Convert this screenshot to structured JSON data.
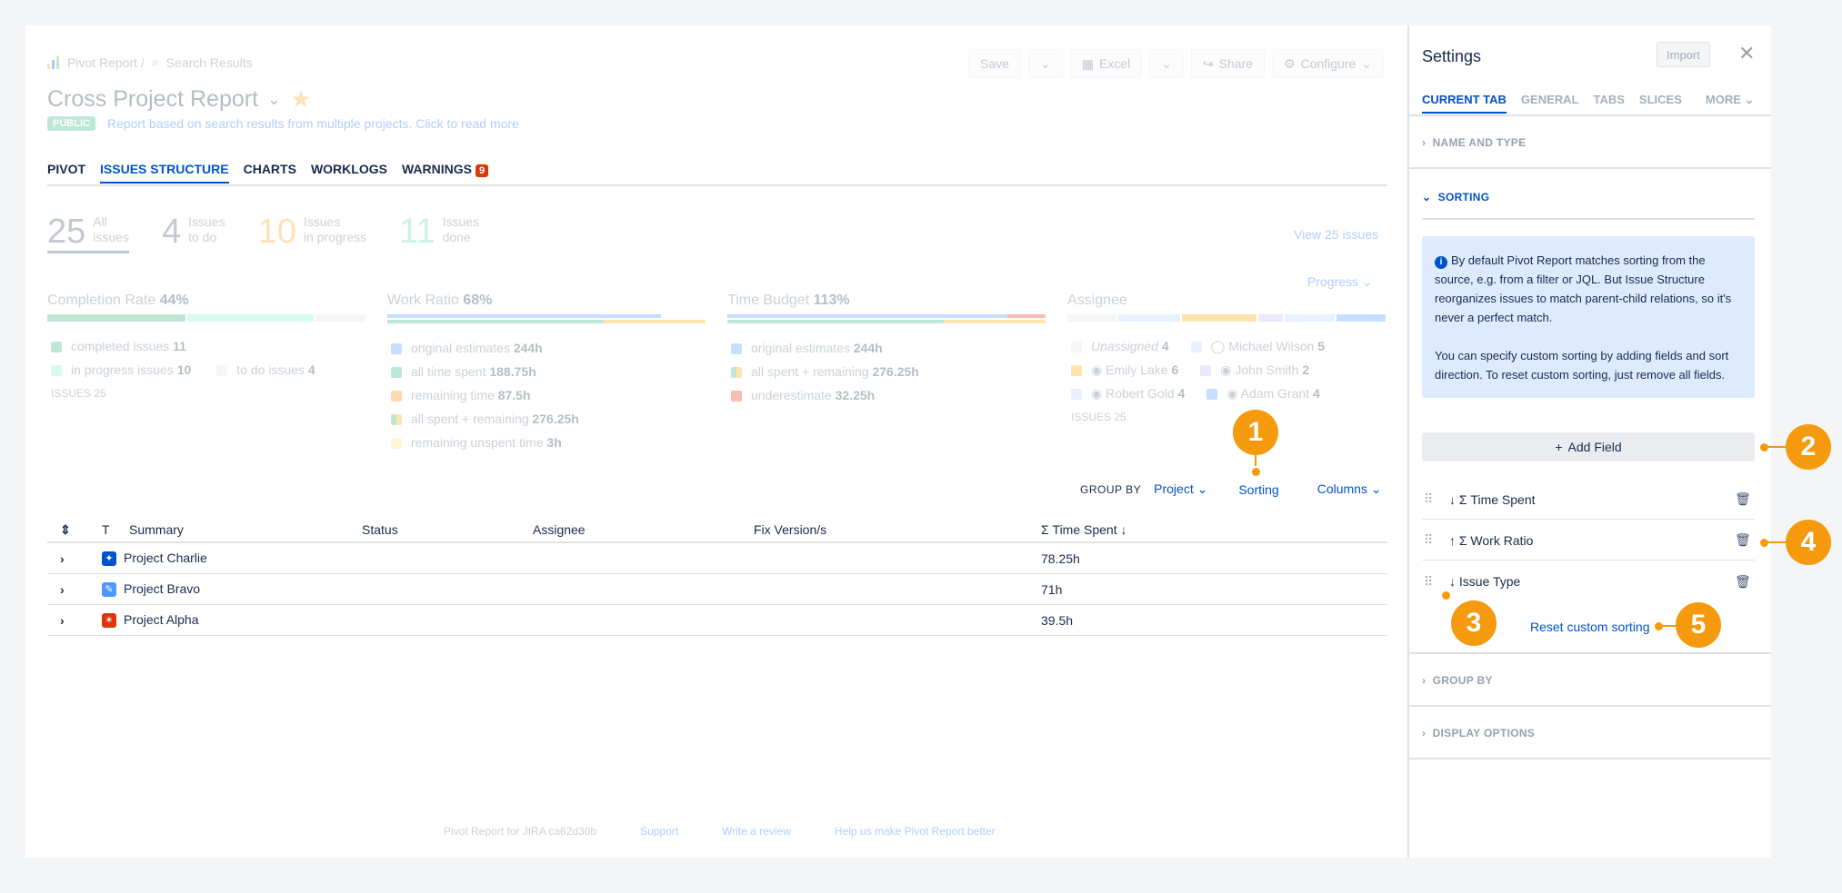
{
  "breadcrumb": {
    "root": "Pivot Report /",
    "current": "Search Results"
  },
  "report": {
    "title": "Cross Project Report",
    "badge": "PUBLIC",
    "description": "Report based on search results from multiple projects. Click to read more"
  },
  "toolbar": {
    "save": "Save",
    "excel": "Excel",
    "share": "Share",
    "configure": "Configure"
  },
  "tabs": [
    {
      "label": "PIVOT"
    },
    {
      "label": "ISSUES STRUCTURE"
    },
    {
      "label": "CHARTS"
    },
    {
      "label": "WORKLOGS"
    },
    {
      "label": "WARNINGS",
      "badge": "9"
    }
  ],
  "stats": [
    {
      "num": "25",
      "l1": "All",
      "l2": "issues",
      "color": "#42526e"
    },
    {
      "num": "4",
      "l1": "Issues",
      "l2": "to do",
      "color": "#42526e"
    },
    {
      "num": "10",
      "l1": "Issues",
      "l2": "in progress",
      "color": "#f5a623"
    },
    {
      "num": "11",
      "l1": "Issues",
      "l2": "done",
      "color": "#57d9a3"
    }
  ],
  "view_issues": "View 25 issues",
  "progress_dropdown": "Progress",
  "metrics": {
    "completion": {
      "title": "Completion Rate",
      "value": "44%",
      "l1": "completed issues",
      "v1": "11",
      "l2": "in progress issues",
      "v2": "10",
      "l3": "to do issues",
      "v3": "4",
      "issues": "ISSUES 25"
    },
    "work": {
      "title": "Work Ratio",
      "value": "68%",
      "l1": "original estimates",
      "v1": "244h",
      "l2": "all time spent",
      "v2": "188.75h",
      "l3": "remaining time",
      "v3": "87.5h",
      "l4": "all spent + remaining",
      "v4": "276.25h",
      "l5": "remaining unspent time",
      "v5": "3h"
    },
    "budget": {
      "title": "Time Budget",
      "value": "113%",
      "l1": "original estimates",
      "v1": "244h",
      "l2": "all spent + remaining",
      "v2": "276.25h",
      "l3": "underestimate",
      "v3": "32.25h"
    },
    "assignee": {
      "title": "Assignee",
      "a1": "Unassigned",
      "v1": "4",
      "a2": "Michael Wilson",
      "v2": "5",
      "a3": "Emily Lake",
      "v3": "6",
      "a4": "John Smith",
      "v4": "2",
      "a5": "Robert Gold",
      "v5": "4",
      "a6": "Adam Grant",
      "v6": "4",
      "issues": "ISSUES 25"
    }
  },
  "groupbar": {
    "group_by_label": "GROUP BY",
    "group_value": "Project",
    "sorting": "Sorting",
    "columns": "Columns"
  },
  "table": {
    "headers": {
      "t": "T",
      "summary": "Summary",
      "status": "Status",
      "assignee": "Assignee",
      "fix": "Fix Version/s",
      "time": "Σ Time Spent"
    },
    "rows": [
      {
        "name": "Project Charlie",
        "time": "78.25h",
        "color": "#0052cc"
      },
      {
        "name": "Project Bravo",
        "time": "71h",
        "color": "#4c9aff"
      },
      {
        "name": "Project Alpha",
        "time": "39.5h",
        "color": "#de350b"
      }
    ]
  },
  "footer": {
    "version": "Pivot Report for JIRA ca62d30b",
    "support": "Support",
    "review": "Write a review",
    "help": "Help us make Pivot Report better"
  },
  "settings": {
    "title": "Settings",
    "import": "Import",
    "tabs": [
      "CURRENT TAB",
      "GENERAL",
      "TABS",
      "SLICES",
      "MORE"
    ],
    "sections": {
      "name_type": "NAME AND TYPE",
      "sorting": "SORTING",
      "group_by": "GROUP BY",
      "display": "DISPLAY OPTIONS"
    },
    "info_p1": "By default Pivot Report matches sorting from the source, e.g. from a filter or JQL. But Issue Structure reorganizes issues to match parent-child relations, so it's never a perfect match.",
    "info_p2": "You can specify custom sorting by adding fields and sort direction. To reset custom sorting, just remove all fields.",
    "add_field": "Add Field",
    "sort_fields": [
      {
        "arrow": "↓",
        "label": "Σ Time Spent"
      },
      {
        "arrow": "↑",
        "label": "Σ Work Ratio"
      },
      {
        "arrow": "↓",
        "label": "Issue Type"
      }
    ],
    "reset": "Reset custom sorting"
  },
  "callouts": [
    "1",
    "2",
    "3",
    "4",
    "5"
  ],
  "colors": {
    "accent": "#0052cc",
    "callout": "#f59a0c"
  }
}
